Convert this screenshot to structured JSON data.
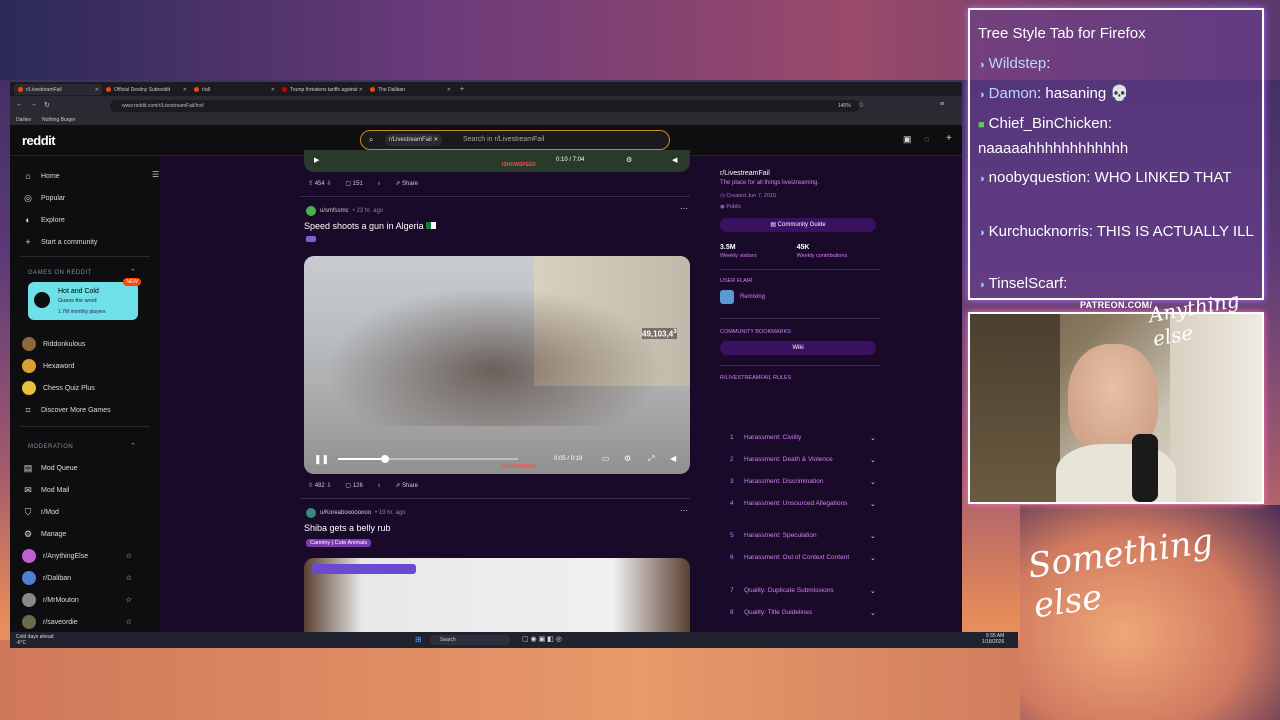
{
  "browser": {
    "tabs": [
      {
        "label": "r/LivestreamFail",
        "active": true
      },
      {
        "label": "Official Destiny Subreddit"
      },
      {
        "label": "r/all"
      },
      {
        "label": "Trump threatens tariffs against"
      },
      {
        "label": "The Daliban"
      }
    ],
    "url": "www.reddit.com/r/LivestreamFail/hot/",
    "zoom": "140%",
    "bookmarks": [
      "Dailies",
      "Nothing Burger"
    ]
  },
  "reddit": {
    "logo": "reddit",
    "search_chip": "r/LivestreamFail",
    "search_placeholder": "Search in r/LivestreamFail"
  },
  "sidebar": {
    "nav": [
      "Home",
      "Popular",
      "Explore",
      "Start a community"
    ],
    "games_heading": "GAMES ON REDDIT",
    "featured_game": {
      "title": "Hot and Cold",
      "subtitle": "Guess the word",
      "players": "1.7M monthly players",
      "badge": "NEW"
    },
    "games": [
      "Riddonkulous",
      "Hexaword",
      "Chess Quiz Plus",
      "Discover More Games"
    ],
    "moderation_heading": "MODERATION",
    "moderation": [
      "Mod Queue",
      "Mod Mail",
      "r/Mod",
      "Manage"
    ],
    "communities": [
      "r/AnythingElse",
      "r/Daliban",
      "r/MrMouton",
      "r/saveordie"
    ]
  },
  "posts": [
    {
      "top_player": {
        "time": "0:10 / 7:04",
        "watermark": "ISHOWSPEED"
      },
      "upvotes": "454",
      "comments": "151",
      "share": "Share"
    },
    {
      "user": "u/smfssmc",
      "age": "• 23 hr. ago",
      "title": "Speed shoots a gun in Algeria",
      "video": {
        "time": "0:05 / 0:19",
        "overlay_count": "49,103,4",
        "overlay_suffix": "3",
        "watermark": "ISHOWSPEED",
        "progress": 0.26
      },
      "upvotes": "482",
      "comments": "126",
      "share": "Share"
    },
    {
      "user": "u/Koreaboooooooo",
      "age": "• 19 hr. ago",
      "title": "Shiba gets a belly rub",
      "flair": "Canniny | Cute Animals"
    }
  ],
  "community": {
    "name": "r/LivestreamFail",
    "description": "The place for all things livestreaming.",
    "created": "Created Jun 7, 2015",
    "visibility": "Public",
    "guide_button": "Community Guide",
    "visitors": "3.5M",
    "visitors_label": "Weekly visitors",
    "contributions": "45K",
    "contributions_label": "Weekly contributions",
    "user_flair_heading": "USER FLAIR",
    "user_flair": "Remixing",
    "bookmarks_heading": "COMMUNITY BOOKMARKS",
    "wiki": "Wiki",
    "rules_heading": "R/LIVESTREAMFAIL RULES",
    "rules": [
      {
        "n": "1",
        "t": "Harassment: Civility"
      },
      {
        "n": "2",
        "t": "Harassment: Death & Violence"
      },
      {
        "n": "3",
        "t": "Harassment: Discrimination"
      },
      {
        "n": "4",
        "t": "Harassment: Unsourced Allegations"
      },
      {
        "n": "5",
        "t": "Harassment: Speculation"
      },
      {
        "n": "6",
        "t": "Harassment: Out of Context Content"
      },
      {
        "n": "7",
        "t": "Quality: Duplicate Submissions"
      },
      {
        "n": "8",
        "t": "Quality: Title Guidelines"
      }
    ]
  },
  "taskbar": {
    "weather": "Cold days ahead",
    "temp": "-6°C",
    "search": "Search",
    "time": "9:35 AM",
    "date": "1/18/2026"
  },
  "chat": [
    {
      "user": "",
      "text": "Tree Style Tab for Firefox"
    },
    {
      "user": "Wildstep",
      "text": ":"
    },
    {
      "user": "Damon",
      "text": ": hasaning 💀"
    },
    {
      "user": "Chief_BinChicken:",
      "text": "naaaaahhhhhhhhhhhh"
    },
    {
      "user": "",
      "text": "noobyquestion: WHO LINKED THAT"
    },
    {
      "user": "",
      "text": "Kurchucknorris: THIS IS ACTUALLY ILL"
    },
    {
      "user": "",
      "text": "TinselScarf:"
    }
  ],
  "overlay": {
    "patreon": "PATREON.COM/",
    "logo_top": "Anything else",
    "logo_bottom": "Something else"
  }
}
